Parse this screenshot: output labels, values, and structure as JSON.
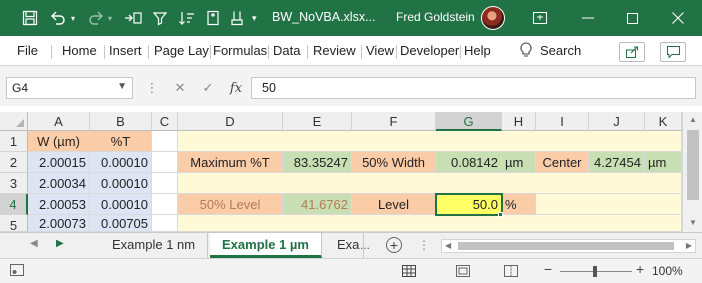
{
  "window": {
    "filename": "BW_NoVBA.xlsx...",
    "user": "Fred Goldstein",
    "colors": {
      "brand": "#217346",
      "accent_selected": "#217346"
    }
  },
  "menu": {
    "items": [
      "File",
      "Home",
      "Insert",
      "Page Lay",
      "Formulas",
      "Data",
      "Review",
      "View",
      "Developer",
      "Help"
    ],
    "search_label": "Search"
  },
  "formula_bar": {
    "name_box": "G4",
    "formula": "50",
    "fx_label": "fx"
  },
  "sheet": {
    "columns": [
      "A",
      "B",
      "C",
      "D",
      "E",
      "F",
      "G",
      "H",
      "I",
      "J",
      "K"
    ],
    "rows": [
      "1",
      "2",
      "3",
      "4",
      "5"
    ],
    "selected_cell": "G4",
    "cells": {
      "A1": "W (µm)",
      "B1": "%T",
      "A2": "2.00015",
      "B2": "0.00010",
      "A3": "2.00034",
      "B3": "0.00010",
      "A4": "2.00053",
      "B4": "0.00010",
      "A5": "2.00073",
      "B5": "0.00705",
      "D2": "Maximum %T",
      "E2": "83.35247",
      "F2": "50% Width",
      "G2": "0.08142",
      "H2": "µm",
      "I2": "Center",
      "J2": "4.27454",
      "K2": "µm",
      "D4": "50% Level",
      "E4": "41.6762",
      "F4": "Level",
      "G4": "50.0",
      "H4": "%"
    }
  },
  "tabs": {
    "items": [
      "Example 1 nm",
      "Example 1 µm",
      "Exa"
    ],
    "active": "Example 1 µm",
    "add_label": "+",
    "more": "..."
  },
  "status": {
    "zoom": "100%"
  }
}
